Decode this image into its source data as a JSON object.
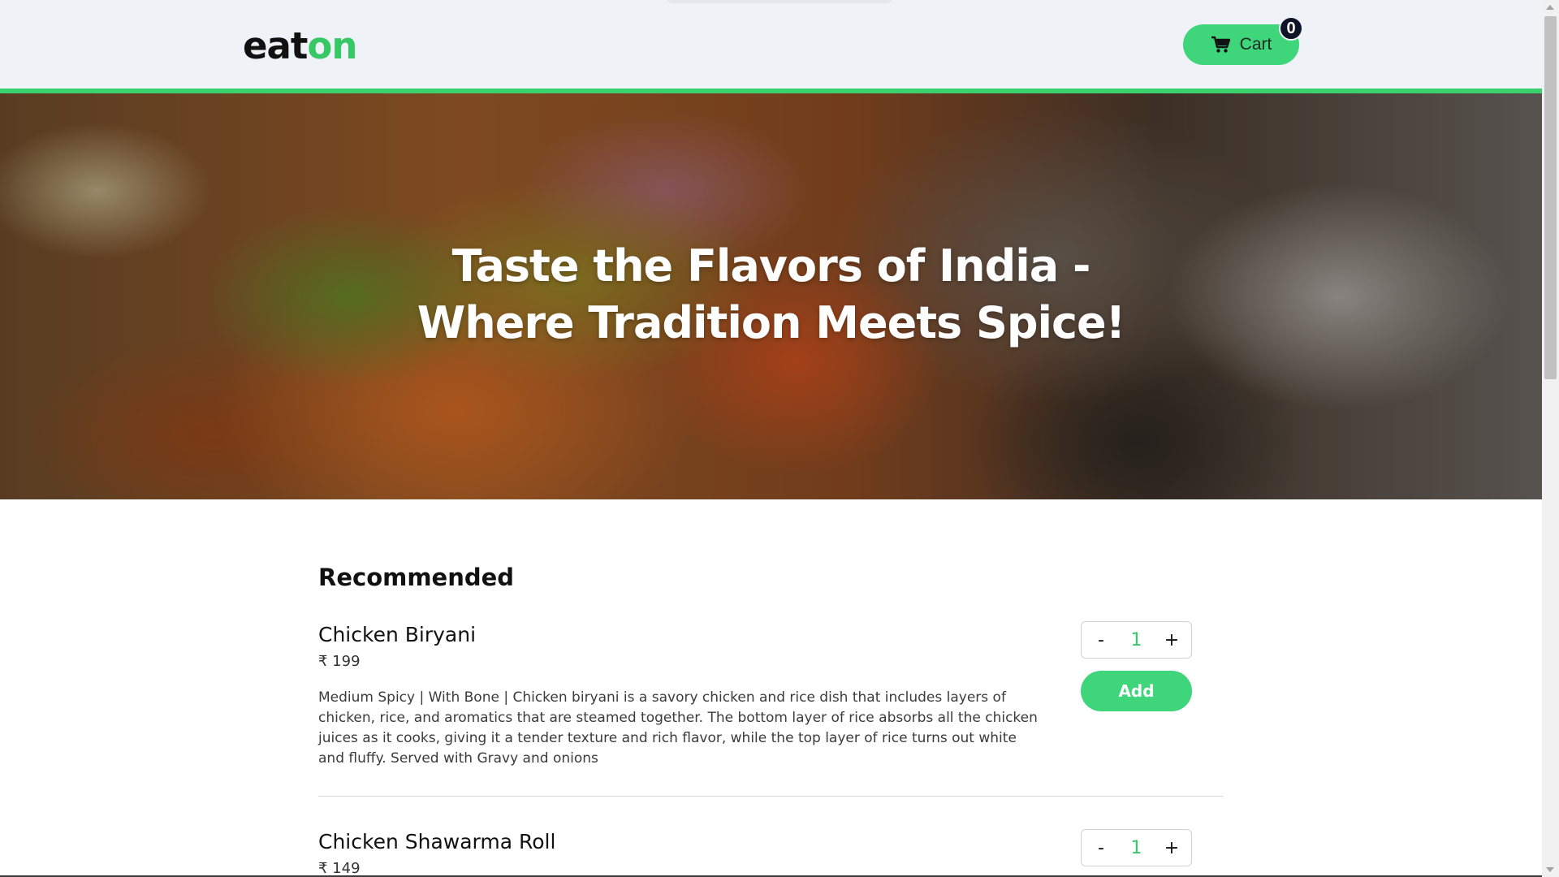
{
  "brand": {
    "logo_part1": "eat",
    "logo_part2": "on"
  },
  "header": {
    "cart_label": "Cart",
    "cart_count": "0",
    "cart_icon": "cart-icon",
    "accent_color": "#3bd16f"
  },
  "hero": {
    "title_line1": "Taste the Flavors of India -",
    "title_line2": "Where Tradition Meets Spice!"
  },
  "menu": {
    "section_title": "Recommended",
    "items": [
      {
        "name": "Chicken Biryani",
        "price": "₹ 199",
        "description": "Medium Spicy | With Bone | Chicken biryani is a savory chicken and rice dish that includes layers of chicken, rice, and aromatics that are steamed together. The bottom layer of rice absorbs all the chicken juices as it cooks, giving it a tender texture and rich flavor, while the top layer of rice turns out white and fluffy. Served with Gravy and onions",
        "quantity": "1",
        "decrement": "-",
        "increment": "+",
        "add_label": "Add"
      },
      {
        "name": "Chicken Shawarma Roll",
        "price": "₹ 149",
        "quantity": "1",
        "decrement": "-",
        "increment": "+"
      }
    ]
  }
}
